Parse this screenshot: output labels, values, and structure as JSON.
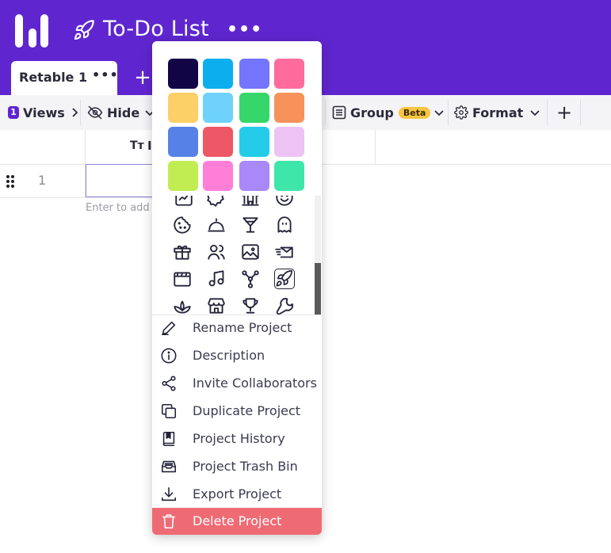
{
  "header": {
    "title": "To-Do List",
    "more": "•••",
    "tab": {
      "label": "Retable 1",
      "more": "•••"
    },
    "add_tab": "+"
  },
  "toolbar": {
    "views_count": "1",
    "views_label": "Views",
    "hide_label": "Hide",
    "group_label": "Group",
    "beta_label": "Beta",
    "format_label": "Format",
    "add": "+"
  },
  "grid": {
    "row_number": "1",
    "enter_hint": "Enter to add",
    "column_type_icon": "Tт",
    "column_initial": "I"
  },
  "popup": {
    "colors": [
      "#120545",
      "#0daeee",
      "#7474fc",
      "#ff6b9d",
      "#fcd067",
      "#6fd2fd",
      "#35d76a",
      "#f7935a",
      "#5681e6",
      "#ee5766",
      "#24ccea",
      "#ecc3f2",
      "#c2ed52",
      "#ff7fd7",
      "#a988f9",
      "#3ee6a9"
    ],
    "icons": [
      "chart-icon",
      "badge-icon",
      "bank-icon",
      "smile-icon",
      "cookie-icon",
      "cloche-icon",
      "cocktail-icon",
      "ghost-icon",
      "gift-icon",
      "users-icon",
      "image-icon",
      "mail-icon",
      "clapperboard-icon",
      "music-icon",
      "network-icon",
      "rocket-icon",
      "lotus-icon",
      "store-icon",
      "trophy-icon",
      "wrench-icon"
    ],
    "selected_icon": "rocket-icon",
    "menu": [
      {
        "label": "Rename Project",
        "icon": "pencil-icon"
      },
      {
        "label": "Description",
        "icon": "info-icon"
      },
      {
        "label": "Invite Collaborators",
        "icon": "share-icon"
      },
      {
        "label": "Duplicate Project",
        "icon": "copy-icon"
      },
      {
        "label": "Project History",
        "icon": "book-icon"
      },
      {
        "label": "Project Trash Bin",
        "icon": "trash-bin-icon"
      },
      {
        "label": "Export Project",
        "icon": "download-icon"
      },
      {
        "label": "Delete Project",
        "icon": "trash-icon"
      }
    ]
  }
}
